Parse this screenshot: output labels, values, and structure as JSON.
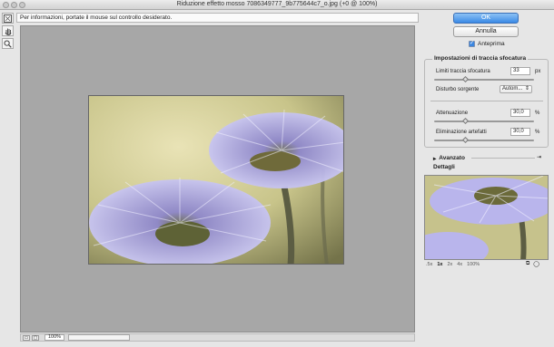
{
  "window": {
    "title": "Riduzione effetto mosso 7086349777_9b775644c7_o.jpg (+0 @ 100%)"
  },
  "infobar": {
    "text": "Per informazioni, portate il mouse sul controllo desiderato."
  },
  "tools": [
    {
      "icon": "trace-blur-tool-icon"
    },
    {
      "icon": "hand-icon"
    },
    {
      "icon": "zoom-icon"
    }
  ],
  "status": {
    "zoom": "100%"
  },
  "buttons": {
    "ok": "OK",
    "cancel": "Annulla"
  },
  "preview": {
    "label": "Anteprima",
    "checked": true
  },
  "settings": {
    "title": "Impostazioni di traccia sfocatura",
    "blur_trace_limit": {
      "label": "Limiti traccia sfocatura",
      "value": "33",
      "unit": "px"
    },
    "source_noise": {
      "label": "Disturbo sorgente",
      "value": "Autom..."
    },
    "smoothing": {
      "label": "Attenuazione",
      "value": "30,0",
      "unit": "%"
    },
    "artifact_suppression": {
      "label": "Eliminazione artefatti",
      "value": "30,0",
      "unit": "%"
    }
  },
  "advanced": {
    "label": "Avanzato"
  },
  "details": {
    "title": "Dettagli",
    "zoom_options": [
      ".5x",
      "1x",
      "2x",
      "4x",
      "100%"
    ],
    "active_zoom": "1x"
  },
  "colors": {
    "ok_button": "#3b8ae6",
    "canvas": "#a7a7a7",
    "panel": "#e6e6e6"
  }
}
